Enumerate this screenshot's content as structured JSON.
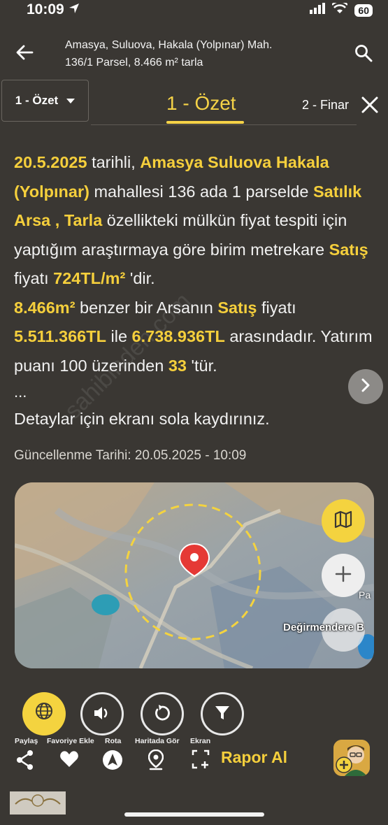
{
  "status_bar": {
    "time": "10:09",
    "battery": "60"
  },
  "header": {
    "title_line1": "Amasya, Suluova, Hakala (Yolpınar) Mah.",
    "title_line2": "136/1 Parsel, 8.466 m² tarla"
  },
  "tabs": {
    "dropdown_label": "1 - Özet",
    "active": "1 - Özet",
    "next": "2 - Finar"
  },
  "summary": {
    "date": "20.5.2025",
    "t1": " tarihli, ",
    "location": "Amasya Suluova Hakala (Yolpınar)",
    "t2": " mahallesi 136 ada 1  parselde ",
    "property": "Satılık Arsa , Tarla",
    "t3": " özellikteki mülkün fiyat tespiti için  yaptığım araştırmaya göre birim metrekare ",
    "sale1": "Satış",
    "t4": " fiyatı ",
    "unit_price": "724TL/m²",
    "t5": " 'dir.",
    "area": "8.466m²",
    "t6": " benzer bir Arsanın  ",
    "sale2": "Satış",
    "t7": " fiyatı",
    "price_min": "5.511.366TL",
    "t8": " ile ",
    "price_max": "6.738.936TL",
    "t9": " arasındadır. Yatırım puanı 100 üzerinden ",
    "score": "33",
    "t10": " 'tür."
  },
  "ellipsis": "...",
  "detail_hint": "Detaylar için ekranı sola kaydırınız.",
  "updated": "Güncellenme Tarihi: 20.05.2025 - 10:09",
  "map": {
    "place_label": "Değirmendere B",
    "partial_label": "Pa"
  },
  "actions": {
    "share": "Paylaş",
    "favorite": "Favoriye Ekle",
    "route": "Rota",
    "show_on_map": "Haritada Gör",
    "screen": "Ekran",
    "report": "Rapor Al"
  },
  "watermark": "sahibinden.com",
  "colors": {
    "accent": "#f5cf3c",
    "background": "#3a3733"
  },
  "icons": [
    "back-arrow-icon",
    "search-icon",
    "chevron-down-icon",
    "close-icon",
    "chevron-right-icon",
    "map-layers-icon",
    "plus-icon",
    "location-pin-icon",
    "globe-icon",
    "volume-icon",
    "refresh-icon",
    "filter-icon",
    "share-icon",
    "heart-icon",
    "navigation-icon",
    "map-pin-icon",
    "screenshot-icon"
  ]
}
